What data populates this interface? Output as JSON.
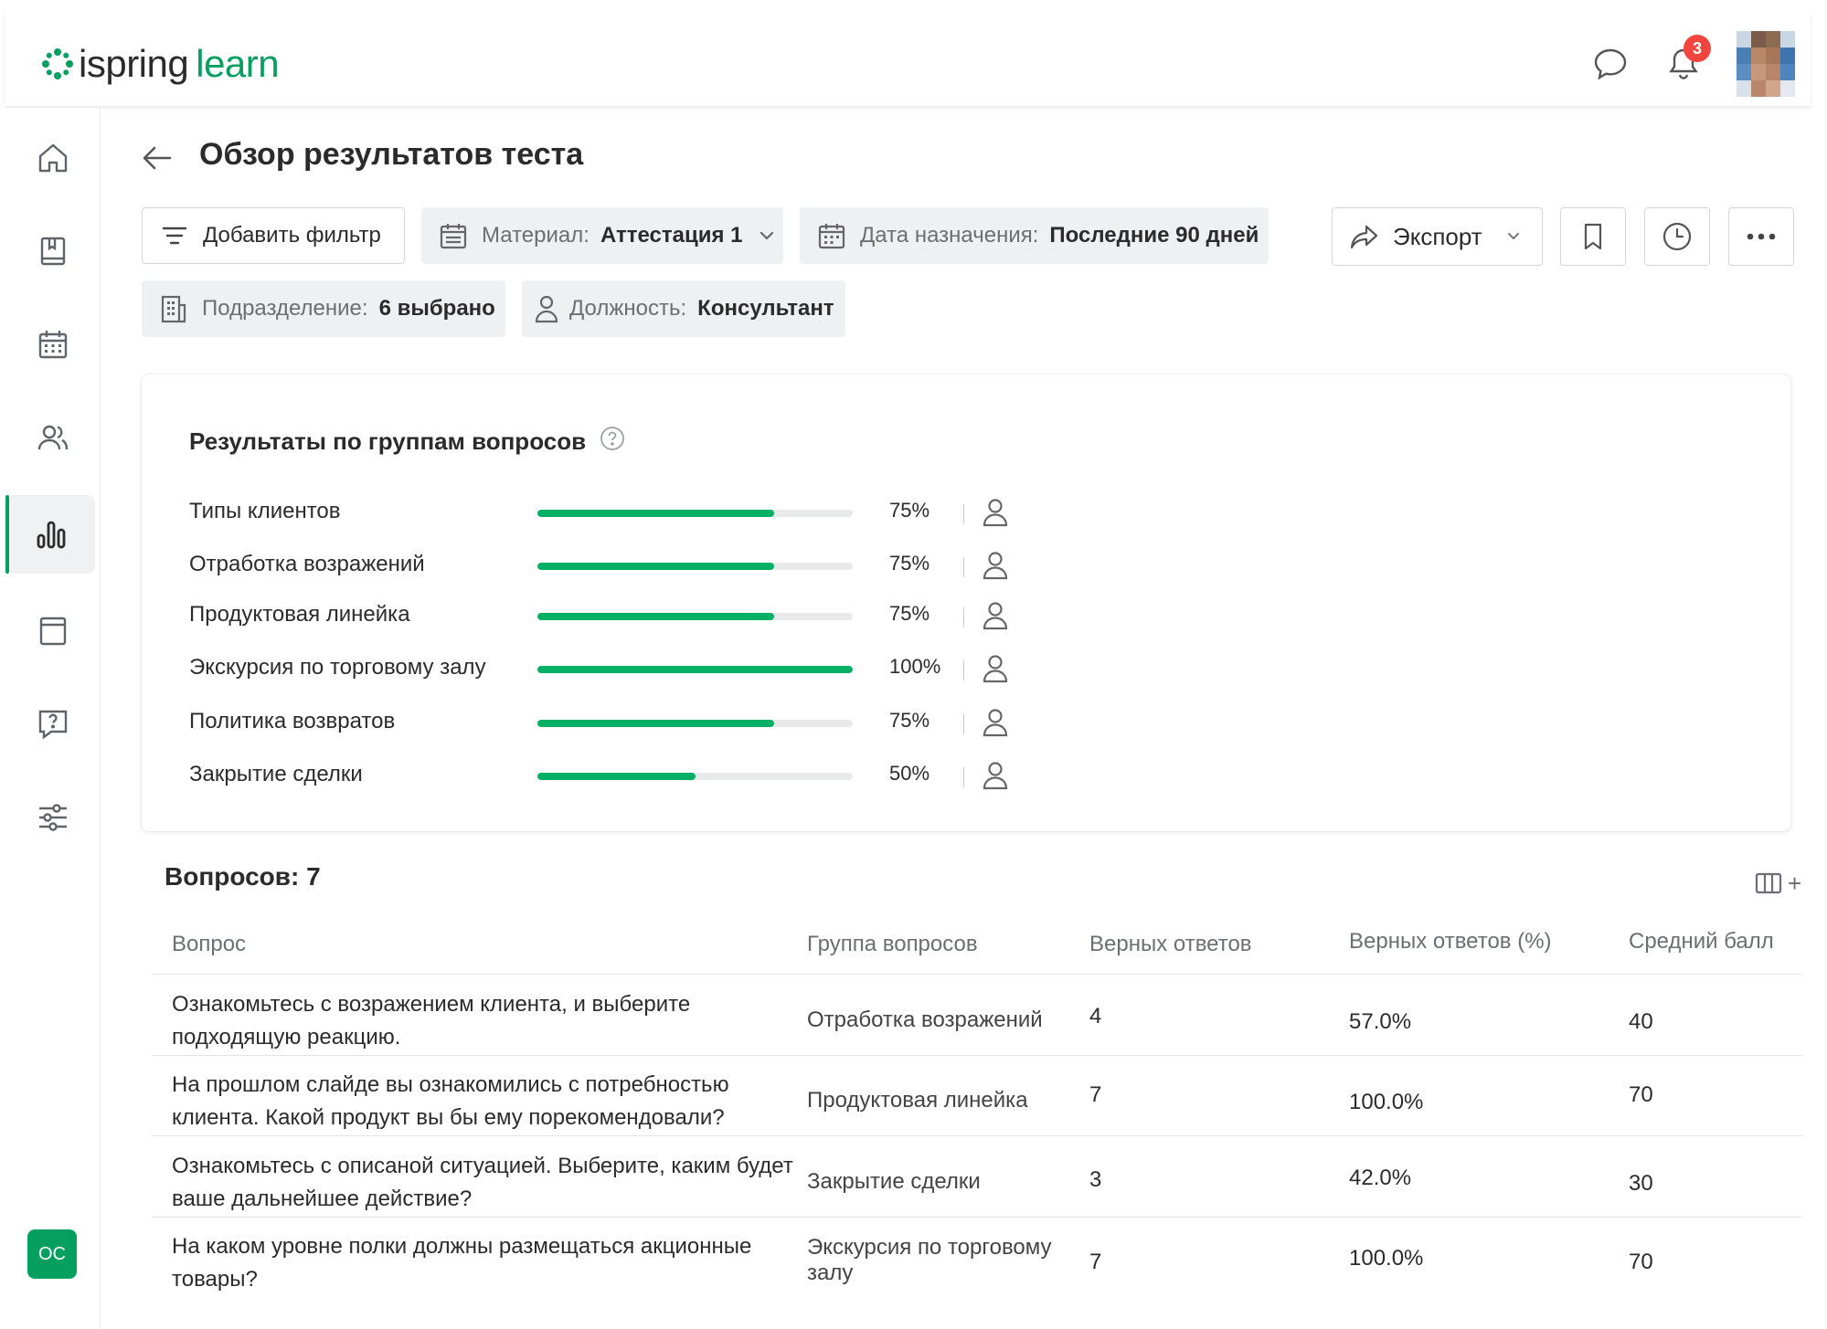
{
  "header": {
    "logo_brand": "ispring",
    "logo_product": "learn",
    "notification_count": "3",
    "user_initials": "OC"
  },
  "page": {
    "title": "Обзор результатов теста"
  },
  "filters": {
    "add_filter": "Добавить фильтр",
    "material_key": "Материал:",
    "material_value": "Аттестация 1",
    "date_key": "Дата назначения:",
    "date_value": "Последние 90 дней",
    "department_key": "Подразделение:",
    "department_value": "6 выбрано",
    "position_key": "Должность:",
    "position_value": "Консультант",
    "export_label": "Экспорт"
  },
  "groups_card": {
    "title": "Результаты по группам вопросов",
    "groups": [
      {
        "label": "Типы клиентов",
        "percent_text": "75%",
        "percent": 0.75
      },
      {
        "label": "Отработка возражений",
        "percent_text": "75%",
        "percent": 0.75
      },
      {
        "label": "Продуктовая линейка",
        "percent_text": "75%",
        "percent": 0.75
      },
      {
        "label": "Экскурсия по торговому залу",
        "percent_text": "100%",
        "percent": 1.0
      },
      {
        "label": "Политика возвратов",
        "percent_text": "75%",
        "percent": 0.75
      },
      {
        "label": "Закрытие сделки",
        "percent_text": "50%",
        "percent": 0.5
      }
    ]
  },
  "questions": {
    "count_label": "Вопросов: 7",
    "columns": [
      "Вопрос",
      "Группа вопросов",
      "Верных ответов",
      "Верных ответов (%)",
      "Средний балл"
    ],
    "rows": [
      {
        "question": "Ознакомьтесь с возражением клиента, и выберите подходящую реакцию.",
        "group": "Отработка возражений",
        "correct": "4",
        "correct_pct": "57.0%",
        "avg_score": "40"
      },
      {
        "question": "На прошлом слайде вы ознакомились с потребностью клиента. Какой продукт вы бы ему порекомендовали?",
        "group": "Продуктовая линейка",
        "correct": "7",
        "correct_pct": "100.0%",
        "avg_score": "70"
      },
      {
        "question": "Ознакомьтесь с описаной ситуацией. Выберите, каким будет ваше дальнейшее действие?",
        "group": "Закрытие сделки",
        "correct": "3",
        "correct_pct": "42.0%",
        "avg_score": "30"
      },
      {
        "question": "На каком уровне полки должны размещаться акционные товары?",
        "group": "Экскурсия по торговому залу",
        "correct": "7",
        "correct_pct": "100.0%",
        "avg_score": "70"
      }
    ]
  },
  "colors": {
    "brand_green": "#05a060",
    "badge_red": "#f2453d",
    "bar_track": "#e7e9eb"
  }
}
